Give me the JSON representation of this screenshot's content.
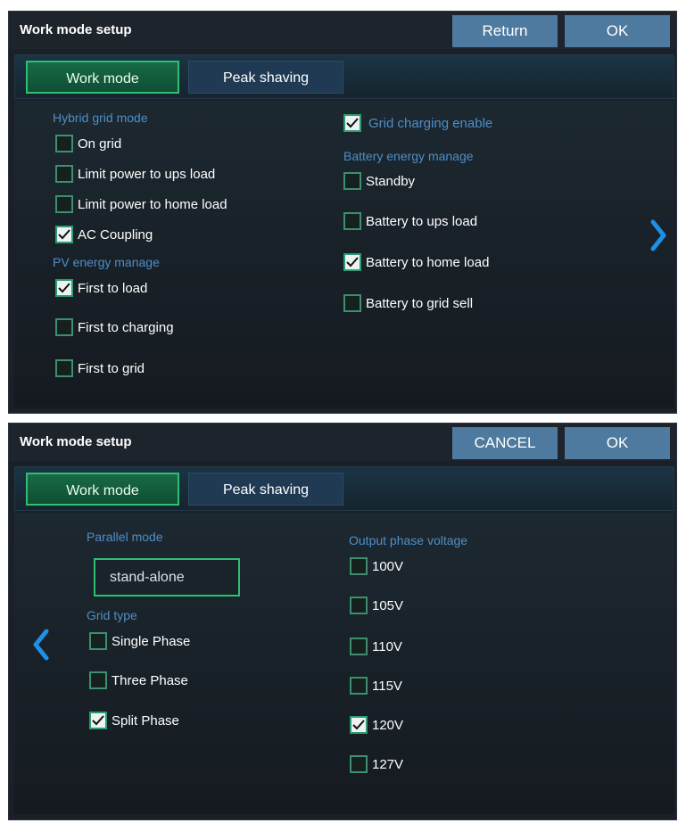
{
  "top": {
    "title": "Work mode setup",
    "buttons": {
      "return": "Return",
      "ok": "OK"
    },
    "tabs": {
      "work_mode": "Work mode",
      "peak_shaving": "Peak shaving"
    },
    "hybrid_grid_mode": {
      "label": "Hybrid grid mode",
      "options": [
        {
          "label": "On grid",
          "checked": false
        },
        {
          "label": "Limit power to ups load",
          "checked": false
        },
        {
          "label": "Limit power to home load",
          "checked": false
        },
        {
          "label": "AC Coupling",
          "checked": true
        }
      ]
    },
    "pv_energy_manage": {
      "label": "PV energy manage",
      "options": [
        {
          "label": "First to load",
          "checked": true
        },
        {
          "label": "First to charging",
          "checked": false
        },
        {
          "label": "First to grid",
          "checked": false
        }
      ]
    },
    "grid_charging": {
      "label": "Grid charging enable",
      "checked": true
    },
    "battery_energy_manage": {
      "label": "Battery energy manage",
      "options": [
        {
          "label": "Standby",
          "checked": false
        },
        {
          "label": "Battery to ups load",
          "checked": false
        },
        {
          "label": "Battery to home load",
          "checked": true
        },
        {
          "label": "Battery to grid sell",
          "checked": false
        }
      ]
    },
    "nav_icon": "chevron-right-icon"
  },
  "bottom": {
    "title": "Work mode setup",
    "buttons": {
      "cancel": "CANCEL",
      "ok": "OK"
    },
    "tabs": {
      "work_mode": "Work mode",
      "peak_shaving": "Peak shaving"
    },
    "parallel_mode": {
      "label": "Parallel mode",
      "value": "stand-alone"
    },
    "grid_type": {
      "label": "Grid type",
      "options": [
        {
          "label": "Single Phase",
          "checked": false
        },
        {
          "label": "Three Phase",
          "checked": false
        },
        {
          "label": "Split Phase",
          "checked": true
        }
      ]
    },
    "output_phase_voltage": {
      "label": "Output phase voltage",
      "options": [
        {
          "label": "100V",
          "checked": false
        },
        {
          "label": "105V",
          "checked": false
        },
        {
          "label": "110V",
          "checked": false
        },
        {
          "label": "115V",
          "checked": false
        },
        {
          "label": "120V",
          "checked": true
        },
        {
          "label": "127V",
          "checked": false
        }
      ]
    },
    "nav_icon": "chevron-left-icon"
  },
  "colors": {
    "accent_green": "#2fbf73",
    "label_blue": "#4e8ec8",
    "button_blue": "#4e7aa0",
    "arrow_blue": "#1e90e8"
  }
}
